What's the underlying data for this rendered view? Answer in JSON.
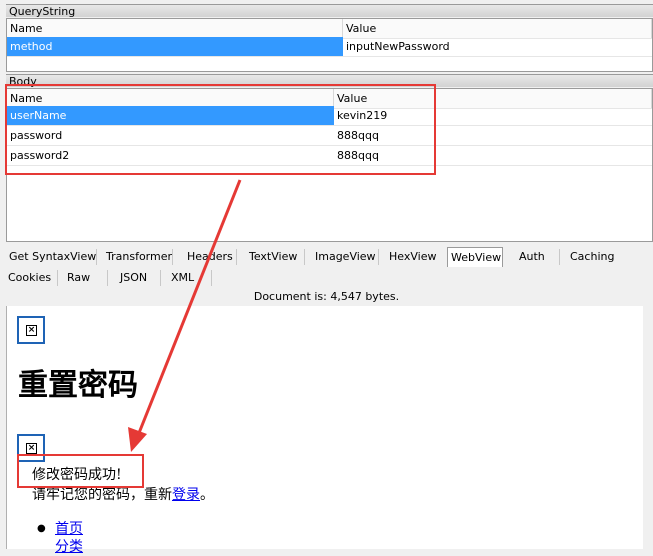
{
  "querystring": {
    "title": "QueryString",
    "headers": [
      "Name",
      "Value"
    ],
    "rows": [
      {
        "name": "method",
        "value": "inputNewPassword"
      }
    ]
  },
  "body": {
    "title": "Body",
    "headers": [
      "Name",
      "Value"
    ],
    "rows": [
      {
        "name": "userName",
        "value": "kevin219"
      },
      {
        "name": "password",
        "value": "888qqq"
      },
      {
        "name": "password2",
        "value": "888qqq"
      }
    ]
  },
  "tabs": {
    "row1": [
      "Get SyntaxView",
      "Transformer",
      "Headers",
      "TextView",
      "ImageView",
      "HexView",
      "WebView",
      "Auth",
      "Caching"
    ],
    "row2": [
      "Cookies",
      "Raw",
      "JSON",
      "XML"
    ],
    "active": "WebView"
  },
  "status": "Document is: 4,547 bytes.",
  "webview": {
    "heading": "重置密码",
    "success": "修改密码成功!",
    "note_prefix": "请牢记您的密码，重新",
    "note_link": "登录",
    "note_suffix": "。",
    "links": [
      "首页",
      "分类"
    ]
  },
  "colors": {
    "selection": "#3399ff",
    "annotation": "#e53935",
    "image_border": "#1e63b5"
  },
  "icons": [
    "broken-image-icon",
    "broken-image-icon"
  ]
}
